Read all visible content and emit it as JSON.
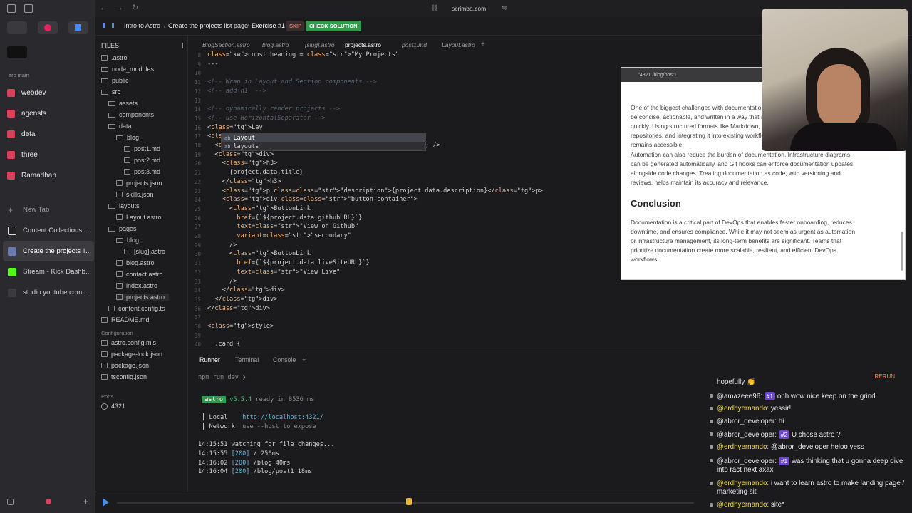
{
  "browser": {
    "url": "scrimba.com",
    "space_label": "arc main",
    "spaces": [
      "webdev",
      "agensts",
      "data",
      "three",
      "Ramadhan"
    ],
    "new_tab": "New Tab",
    "tabs": [
      "Content Collections...",
      "Create the projects li...",
      "Stream - Kick Dashb...",
      "studio.youtube.com..."
    ]
  },
  "breadcrumb": {
    "course": "Intro to Astro",
    "lesson": "Create the projects list page",
    "exercise": "Exercise #1",
    "skip": "SKIP",
    "check": "CHECK SOLUTION"
  },
  "files": {
    "header": "FILES",
    "items": [
      ".astro",
      "node_modules",
      "public",
      "src",
      "assets",
      "components",
      "data",
      "blog",
      "post1.md",
      "post2.md",
      "post3.md",
      "projects.json",
      "skills.json",
      "layouts",
      "Layout.astro",
      "pages",
      "blog",
      "[slug].astro",
      "blog.astro",
      "contact.astro",
      "index.astro",
      "projects.astro",
      "content.config.ts",
      "README.md"
    ],
    "config_header": "Configuration",
    "config_items": [
      "astro.config.mjs",
      "package-lock.json",
      "package.json",
      "tsconfig.json"
    ],
    "ports_header": "Ports",
    "port": "4321"
  },
  "editor": {
    "tabs": [
      "BlogSection.astro",
      "blog.astro",
      "[slug].astro",
      "projects.astro",
      "post1.md",
      "Layout.astro"
    ],
    "line_numbers": [
      "8",
      "9",
      "10",
      "11",
      "12",
      "13",
      "14",
      "15",
      "16",
      "17",
      "18",
      "19",
      "20",
      "21",
      "22",
      "23",
      "24",
      "25",
      "26",
      "27",
      "28",
      "29",
      "30",
      "31",
      "32",
      "33",
      "34",
      "35",
      "36",
      "37",
      "38",
      "39",
      "40"
    ],
    "lines": [
      "const heading = \"My Projects\"",
      "---",
      "",
      "<!-- Wrap in Layout and Section components -->",
      "<!-- add h1  -->",
      "",
      "<!-- dynamically render projects -->",
      "<!-- use HorizontalSeparator -->",
      "<Lay",
      "<div",
      "  <i",
      "  <div>",
      "    <h3>",
      "      {project.data.title}",
      "    </h3>",
      "    <p class=\"description\">{project.data.description}</p>",
      "    <div class=\"button-container\">",
      "      <ButtonLink",
      "        href={`${project.data.githubURL}`}",
      "        text=\"View on Github\"",
      "        variant=\"secondary\"",
      "      />",
      "      <ButtonLink",
      "        href={`${project.data.liveSiteURL}`}",
      "        text=\"View Live\"",
      "      />",
      "    </div>",
      "  </div>",
      "</div>",
      "",
      "<style>",
      "",
      "  .card {"
    ],
    "line18_tail": "} />",
    "autocomplete": [
      "Layout",
      "layouts"
    ]
  },
  "preview": {
    "url": ":4321 /blog/post1",
    "para1": [
      "One of the biggest challenges with documentation is keeping it up to date. Documentation should",
      "be concise, actionable, and written in a way that allows new team members to onboard",
      "quickly. Using structured formats like Markdown, version-controlled documentation",
      "repositories, and integrating it into existing workflows ensures that documentation",
      "remains accessible."
    ],
    "para2": [
      "Automation can also reduce the burden of documentation. Infrastructure diagrams",
      "can be generated automatically, and Git hooks can enforce documentation updates",
      "alongside code changes. Treating documentation as code, with versioning and",
      "reviews, helps maintain its accuracy and relevance."
    ],
    "heading": "Conclusion",
    "para3": [
      "Documentation is a critical part of DevOps that enables faster onboarding, reduces",
      "downtime, and ensures compliance. While it may not seem as urgent as automation",
      "or infrastructure management, its long-term benefits are significant. Teams that",
      "prioritize documentation create more scalable, resilient, and efficient DevOps",
      "workflows."
    ]
  },
  "runner": {
    "tabs": [
      "Runner",
      "Terminal",
      "Console"
    ],
    "command": "npm run dev",
    "astro": "astro",
    "version": "v5.5.4",
    "ready": "ready in 8536 ms",
    "local_label": "Local",
    "local_url": "http://localhost:4321/",
    "network_label": "Network",
    "network_val": "use --host to expose",
    "watching": "14:15:51 watching for file changes...",
    "logs": [
      {
        "time": "14:15:55",
        "code": "[200]",
        "path": "/ 250ms"
      },
      {
        "time": "14:16:02",
        "code": "[200]",
        "path": "/blog 40ms"
      },
      {
        "time": "14:16:04",
        "code": "[200]",
        "path": "/blog/post1 18ms"
      }
    ]
  },
  "chat": {
    "rerun": "RERUN",
    "top": "hopefully 👏",
    "messages": [
      {
        "user": "@amazeee96:",
        "badge": "#1",
        "text": "ohh wow nice keep on the grind",
        "hl": false
      },
      {
        "user": "@erdhyernando:",
        "badge": "",
        "text": "yessir!",
        "hl": true
      },
      {
        "user": "@abror_developer:",
        "badge": "",
        "text": "hi",
        "hl": false
      },
      {
        "user": "@abror_developer:",
        "badge": "#2",
        "text": "U chose astro ?",
        "hl": false
      },
      {
        "user": "@erdhyernando:",
        "badge": "",
        "text": "@abror_developer heloo yess",
        "hl": true
      },
      {
        "user": "@abror_developer:",
        "badge": "#1",
        "text": "was thinking that u gonna deep dive into ract next axax",
        "hl": false
      },
      {
        "user": "@erdhyernando:",
        "badge": "",
        "text": "i want to learn astro to make landing page / marketing sit",
        "hl": true
      },
      {
        "user": "@erdhyernando:",
        "badge": "",
        "text": "site*",
        "hl": true
      }
    ]
  }
}
